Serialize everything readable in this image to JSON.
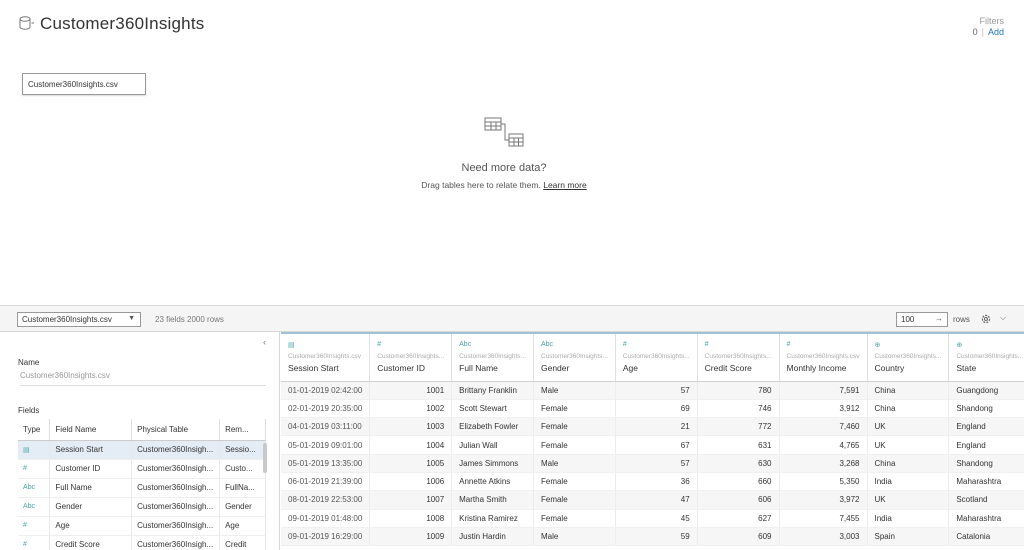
{
  "header": {
    "title": "Customer360Insights",
    "icon": "database-icon"
  },
  "filters": {
    "label": "Filters",
    "count": "0",
    "add_label": "Add"
  },
  "canvas": {
    "table_chip": "Customer360Insights.csv",
    "empty_title": "Need more data?",
    "empty_text": "Drag tables here to relate them.",
    "learn_more": "Learn more"
  },
  "toolbar": {
    "datasource": "Customer360Insights.csv",
    "summary": "23 fields 2000 rows",
    "rows_value": "100",
    "rows_label": "rows"
  },
  "metadata": {
    "name_label": "Name",
    "name_value": "Customer360Insights.csv",
    "fields_label": "Fields",
    "columns": [
      "Type",
      "Field Name",
      "Physical Table",
      "Rem..."
    ],
    "rows": [
      {
        "type": "date",
        "field": "Session Start",
        "table": "Customer360Insigh...",
        "remote": "Sessio..."
      },
      {
        "type": "#",
        "field": "Customer ID",
        "table": "Customer360Insigh...",
        "remote": "Custo..."
      },
      {
        "type": "Abc",
        "field": "Full Name",
        "table": "Customer360Insigh...",
        "remote": "FullNa..."
      },
      {
        "type": "Abc",
        "field": "Gender",
        "table": "Customer360Insigh...",
        "remote": "Gender"
      },
      {
        "type": "#",
        "field": "Age",
        "table": "Customer360Insigh...",
        "remote": "Age"
      },
      {
        "type": "#",
        "field": "Credit Score",
        "table": "Customer360Insigh...",
        "remote": "Credit"
      }
    ]
  },
  "grid": {
    "columns": [
      {
        "icon": "date",
        "source": "Customer360Insights.csv",
        "name": "Session Start"
      },
      {
        "icon": "#",
        "source": "Customer360Insights...",
        "name": "Customer ID"
      },
      {
        "icon": "Abc",
        "source": "Customer360Insights...",
        "name": "Full Name"
      },
      {
        "icon": "Abc",
        "source": "Customer360Insights...",
        "name": "Gender"
      },
      {
        "icon": "#",
        "source": "Customer360Insights...",
        "name": "Age"
      },
      {
        "icon": "#",
        "source": "Customer360Insights...",
        "name": "Credit Score"
      },
      {
        "icon": "#",
        "source": "Customer360Insights.csv",
        "name": "Monthly Income"
      },
      {
        "icon": "globe",
        "source": "Customer360Insights...",
        "name": "Country"
      },
      {
        "icon": "globe",
        "source": "Customer360Insights...",
        "name": "State"
      }
    ],
    "rows": [
      [
        "01-01-2019 02:42:00",
        "1001",
        "Brittany Franklin",
        "Male",
        "57",
        "780",
        "7,591",
        "China",
        "Guangdong"
      ],
      [
        "02-01-2019 20:35:00",
        "1002",
        "Scott Stewart",
        "Female",
        "69",
        "746",
        "3,912",
        "China",
        "Shandong"
      ],
      [
        "04-01-2019 03:11:00",
        "1003",
        "Elizabeth Fowler",
        "Female",
        "21",
        "772",
        "7,460",
        "UK",
        "England"
      ],
      [
        "05-01-2019 09:01:00",
        "1004",
        "Julian Wall",
        "Female",
        "67",
        "631",
        "4,765",
        "UK",
        "England"
      ],
      [
        "05-01-2019 13:35:00",
        "1005",
        "James Simmons",
        "Male",
        "57",
        "630",
        "3,268",
        "China",
        "Shandong"
      ],
      [
        "06-01-2019 21:39:00",
        "1006",
        "Annette Atkins",
        "Female",
        "36",
        "660",
        "5,350",
        "India",
        "Maharashtra"
      ],
      [
        "08-01-2019 22:53:00",
        "1007",
        "Martha Smith",
        "Female",
        "47",
        "606",
        "3,972",
        "UK",
        "Scotland"
      ],
      [
        "09-01-2019 01:48:00",
        "1008",
        "Kristina Ramirez",
        "Female",
        "45",
        "627",
        "7,455",
        "India",
        "Maharashtra"
      ],
      [
        "09-01-2019 16:29:00",
        "1009",
        "Justin Hardin",
        "Male",
        "59",
        "609",
        "3,003",
        "Spain",
        "Catalonia"
      ]
    ]
  }
}
